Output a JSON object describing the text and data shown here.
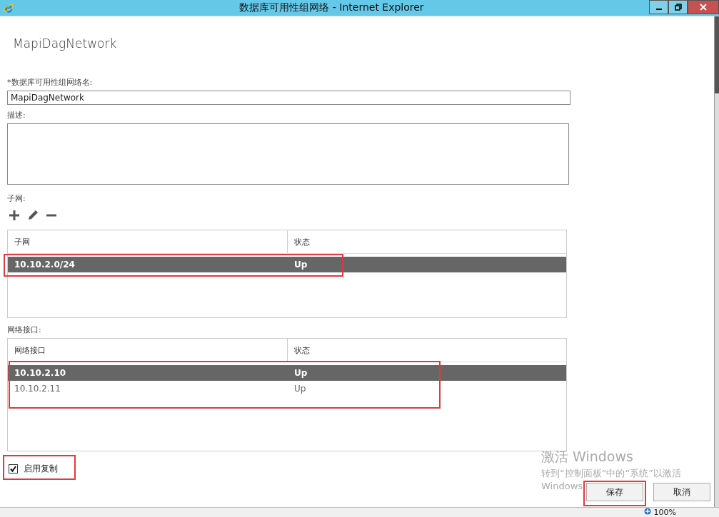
{
  "window": {
    "title": "数据库可用性组网络 - Internet Explorer"
  },
  "heading": "MapiDagNetwork",
  "name_field": {
    "label": "*数据库可用性组网络名:",
    "value": "MapiDagNetwork"
  },
  "description_field": {
    "label": "描述:"
  },
  "subnets": {
    "label": "子网:",
    "columns": [
      "子网",
      "状态"
    ],
    "rows": [
      {
        "cells": [
          "10.10.2.0/24",
          "Up"
        ],
        "selected": true
      }
    ]
  },
  "interfaces": {
    "label": "网络接口:",
    "columns": [
      "网络接口",
      "状态"
    ],
    "rows": [
      {
        "cells": [
          "10.10.2.10",
          "Up"
        ],
        "selected": true
      },
      {
        "cells": [
          "10.10.2.11",
          "Up"
        ],
        "selected": false
      }
    ]
  },
  "replication": {
    "label": "启用复制",
    "checked": true
  },
  "buttons": [
    "保存",
    "取消"
  ],
  "activation": {
    "title": "激活 Windows",
    "lines": [
      "转到“控制面板”中的“系统”以激活",
      "Windows"
    ]
  },
  "status_bar": {
    "zoom": "100%"
  }
}
